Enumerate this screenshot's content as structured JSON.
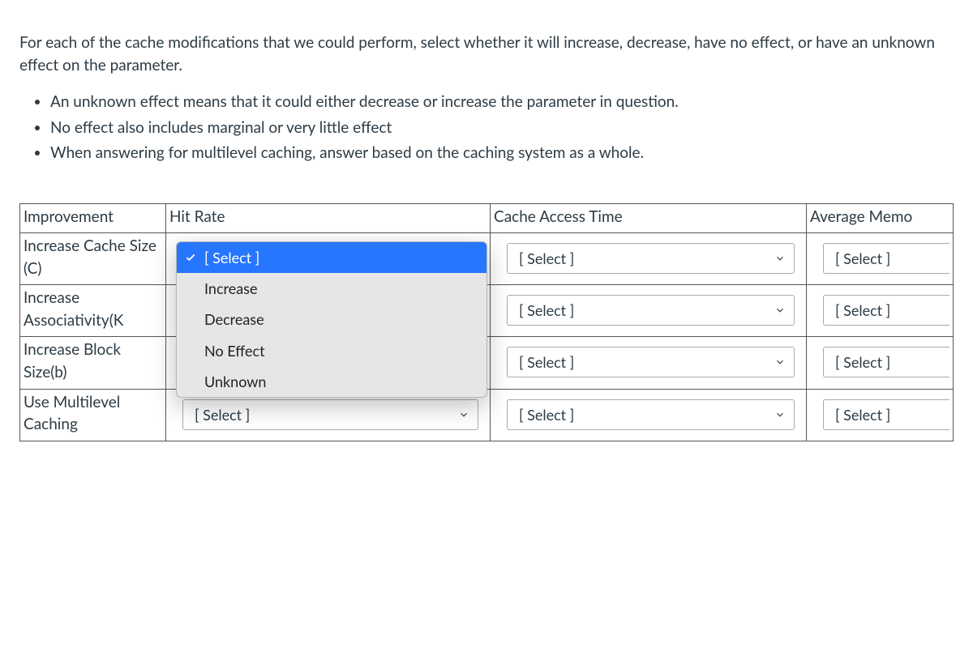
{
  "intro": "For each of the cache modifications that we could perform, select whether it will increase, decrease, have no effect, or have an unknown effect on the parameter.",
  "notes": [
    "An unknown effect means that it could either decrease or increase the parameter in question.",
    "No effect also includes marginal or very little effect",
    "When answering for multilevel caching, answer based on the caching system as a whole."
  ],
  "table": {
    "columns": [
      "Improvement",
      "Hit Rate",
      "Cache Access Time",
      "Average Memo"
    ],
    "placeholder": "[ Select ]",
    "rows": [
      {
        "label": "Increase Cache Size (C)"
      },
      {
        "label": "Increase Associativity(K"
      },
      {
        "label": "Increase Block Size(b)"
      },
      {
        "label": "Use Multilevel Caching"
      }
    ],
    "dropdown_options": [
      "[ Select ]",
      "Increase",
      "Decrease",
      "No Effect",
      "Unknown"
    ]
  }
}
